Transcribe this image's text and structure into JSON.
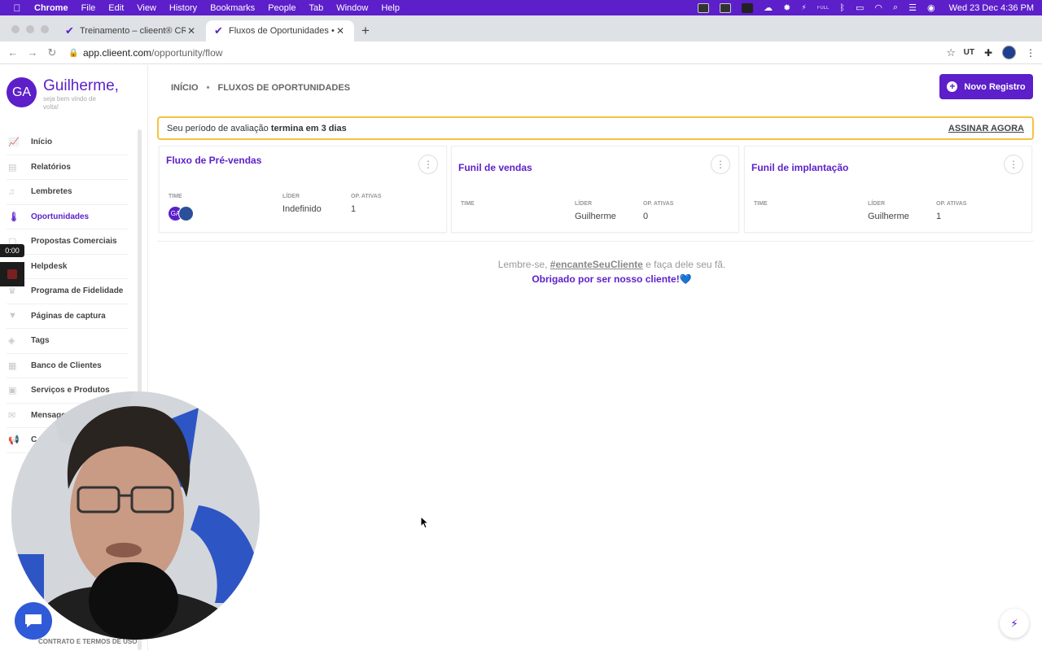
{
  "menubar": {
    "app": "Chrome",
    "items": [
      "File",
      "Edit",
      "View",
      "History",
      "Bookmarks",
      "People",
      "Tab",
      "Window",
      "Help"
    ],
    "clock": "Wed 23 Dec  4:36 PM",
    "battery_label": "FULL"
  },
  "tabs": [
    {
      "title": "Treinamento – clieent® CRM"
    },
    {
      "title": "Fluxos de Oportunidades • clie"
    }
  ],
  "address": {
    "host": "app.clieent.com",
    "path": "/opportunity/flow"
  },
  "user": {
    "initials": "GA",
    "name": "Guilherme,",
    "subtitle": "seja bem vindo de volta!"
  },
  "sidebar": {
    "items": [
      {
        "label": "Início",
        "icon": "chart-icon"
      },
      {
        "label": "Relatórios",
        "icon": "document-icon"
      },
      {
        "label": "Lembretes",
        "icon": "bell-icon"
      },
      {
        "label": "Oportunidades",
        "icon": "thermometer-icon",
        "active": true
      },
      {
        "label": "Propostas Comerciais",
        "icon": "file-icon"
      },
      {
        "label": "Helpdesk",
        "icon": "headset-icon"
      },
      {
        "label": "Programa de Fidelidade",
        "icon": "trophy-icon"
      },
      {
        "label": "Páginas de captura",
        "icon": "filter-icon"
      },
      {
        "label": "Tags",
        "icon": "tag-icon"
      },
      {
        "label": "Banco de Clientes",
        "icon": "database-icon"
      },
      {
        "label": "Serviços e Produtos",
        "icon": "box-icon"
      },
      {
        "label": "Mensagens",
        "icon": "mail-icon"
      },
      {
        "label": "C",
        "icon": "megaphone-icon"
      }
    ],
    "footer": "CONTRATO E TERMOS DE USO"
  },
  "breadcrumb": {
    "home": "INÍCIO",
    "current": "FLUXOS DE OPORTUNIDADES"
  },
  "new_button": "Novo Registro",
  "trial": {
    "prefix": "Seu período de avaliação ",
    "bold": "termina em 3 dias",
    "cta": "ASSINAR AGORA"
  },
  "labels": {
    "team": "TIME",
    "leader": "LÍDER",
    "active_ops": "OP. ATIVAS"
  },
  "cards": [
    {
      "title": "Fluxo de Pré-vendas",
      "leader": "Indefinido",
      "active": "1",
      "team_initials": "GA"
    },
    {
      "title": "Funil de vendas",
      "leader": "Guilherme",
      "active": "0"
    },
    {
      "title": "Funil de implantação",
      "leader": "Guilherme",
      "active": "1"
    }
  ],
  "footer_msg": {
    "pre": "Lembre-se, ",
    "tag": "#encanteSeuCliente",
    "post": " e faça dele seu fã.",
    "thanks": "Obrigado por ser nosso cliente!💙"
  },
  "recorder": {
    "time": "0:00"
  },
  "colors": {
    "brand": "#5c1fc9",
    "trial_border": "#f5c242",
    "chat": "#2f5ad8"
  }
}
